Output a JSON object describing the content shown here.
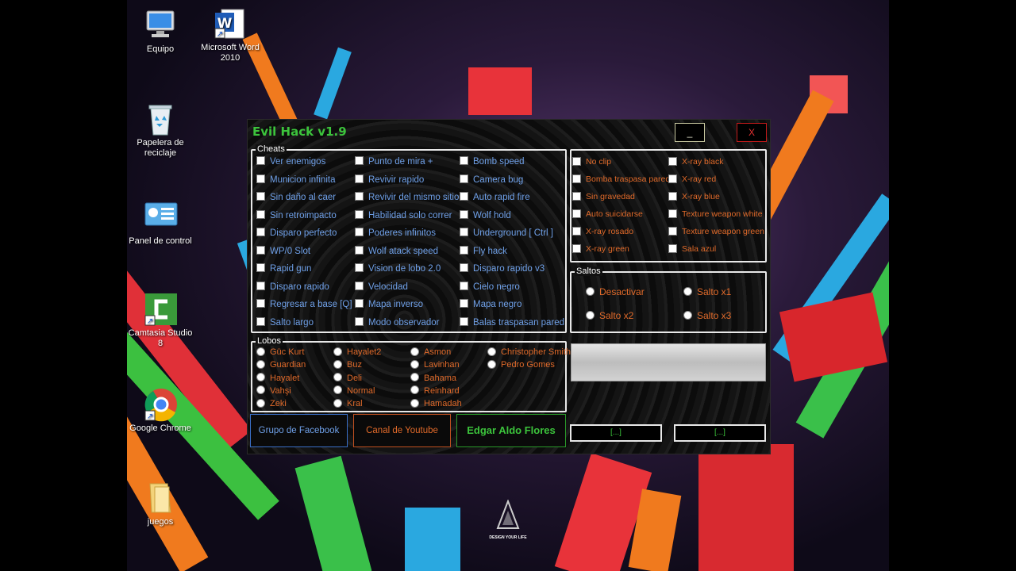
{
  "desktop_icons": {
    "equipo": "Equipo",
    "word": "Microsoft Word 2010",
    "papelera": "Papelera de reciclaje",
    "panel": "Panel de control",
    "camtasia": "Camtasia Studio 8",
    "chrome": "Google Chrome",
    "juegos": "juegos"
  },
  "watermark": "DESIGN YOUR LIFE",
  "window": {
    "title": "Evil Hack v1.9",
    "minimize": "_",
    "close": "X"
  },
  "cheats": {
    "label": "Cheats",
    "col1": [
      "Ver enemigos",
      "Municion infinita",
      "Sin daño al caer",
      "Sin retroimpacto",
      "Disparo perfecto",
      "WP/0 Slot",
      "Rapid gun",
      "Disparo rapido",
      "Regresar a base [Q]",
      "Salto largo"
    ],
    "col2": [
      "Punto de mira +",
      "Revivir rapido",
      "Revivir del mismo sitio",
      "Habilidad solo correr",
      "Poderes infinitos",
      "Wolf atack speed",
      "Vision de lobo 2.0",
      "Velocidad",
      "Mapa inverso",
      "Modo observador"
    ],
    "col3": [
      "Bomb speed",
      "Camera bug",
      "Auto rapid fire",
      "Wolf hold",
      "Underground [ Ctrl ]",
      "Fly hack",
      "Disparo rapido v3",
      "Cielo negro",
      "Mapa negro",
      "Balas traspasan pared"
    ]
  },
  "extras": {
    "col1": [
      "No clip",
      "Bomba traspasa pared",
      "Sin gravedad",
      "Auto suicidarse",
      "X-ray rosado",
      "X-ray green"
    ],
    "col2": [
      "X-ray black",
      "X-ray red",
      "X-ray blue",
      "Texture weapon white",
      "Texture weapon green",
      "Sala azul"
    ]
  },
  "saltos": {
    "label": "Saltos",
    "options": [
      "Desactivar",
      "Salto x1",
      "Salto x2",
      "Salto x3"
    ]
  },
  "lobos": {
    "label": "Lobos",
    "col1": [
      "Güc Kurt",
      "Guardian",
      "Hayalet",
      "Vahşi",
      "Zeki"
    ],
    "col2": [
      "Hayalet2",
      "Buz",
      "Deli",
      "Normal",
      "Kral"
    ],
    "col3": [
      "Asmon",
      "Lavinhan",
      "Bahama",
      "Reinhard",
      "Hamadah"
    ],
    "col4": [
      "Christopher Smith",
      "Pedro Gomes"
    ]
  },
  "buttons": {
    "facebook": "Grupo de Facebook",
    "youtube": "Canal de Youtube",
    "author": "Edgar Aldo Flores",
    "small1": "[...]",
    "small2": "[...]"
  },
  "colors": {
    "accent_green": "#3cc43c",
    "option_blue": "#6fa0e8",
    "option_orange": "#e06a2a",
    "close_red": "#e23030"
  }
}
